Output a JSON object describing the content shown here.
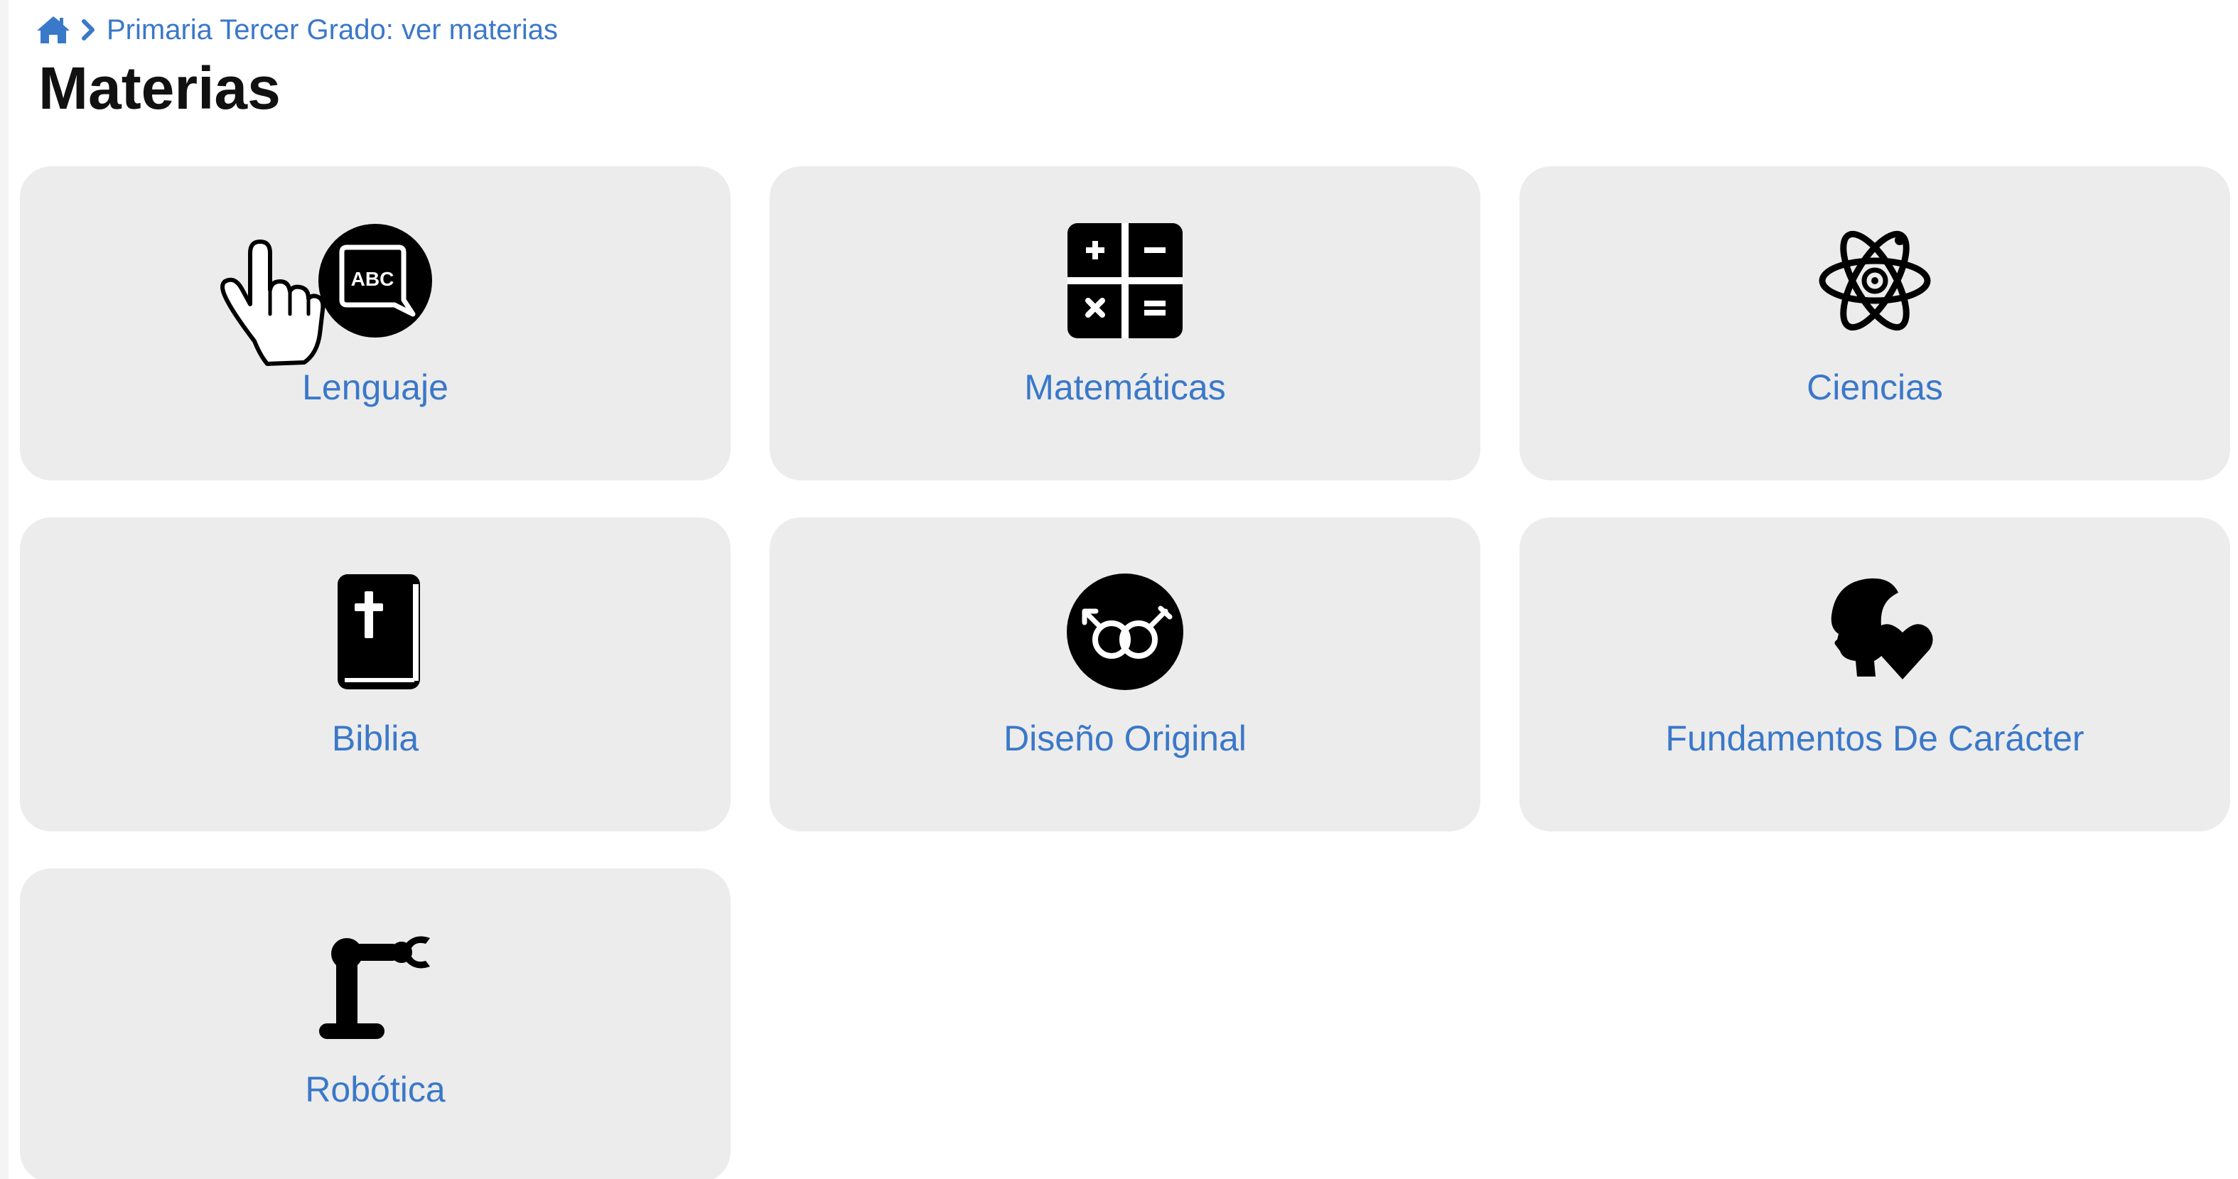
{
  "breadcrumb": {
    "home_icon": "home-icon",
    "separator_icon": "chevron-right-icon",
    "current": "Primaria Tercer Grado: ver materias"
  },
  "page": {
    "title": "Materias"
  },
  "subjects": [
    {
      "label": "Lenguaje",
      "icon": "abc-speech-bubble-icon"
    },
    {
      "label": "Matemáticas",
      "icon": "calculator-icon"
    },
    {
      "label": "Ciencias",
      "icon": "atom-icon"
    },
    {
      "label": "Biblia",
      "icon": "bible-icon"
    },
    {
      "label": "Diseño Original",
      "icon": "gender-symbols-icon"
    },
    {
      "label": "Fundamentos De Carácter",
      "icon": "head-heart-icon"
    },
    {
      "label": "Robótica",
      "icon": "robot-arm-icon"
    }
  ],
  "colors": {
    "link": "#3a78c9",
    "card_background": "#ececec",
    "title": "#111111",
    "icon": "#000000"
  },
  "cursor": {
    "icon": "hand-pointer-cursor"
  }
}
